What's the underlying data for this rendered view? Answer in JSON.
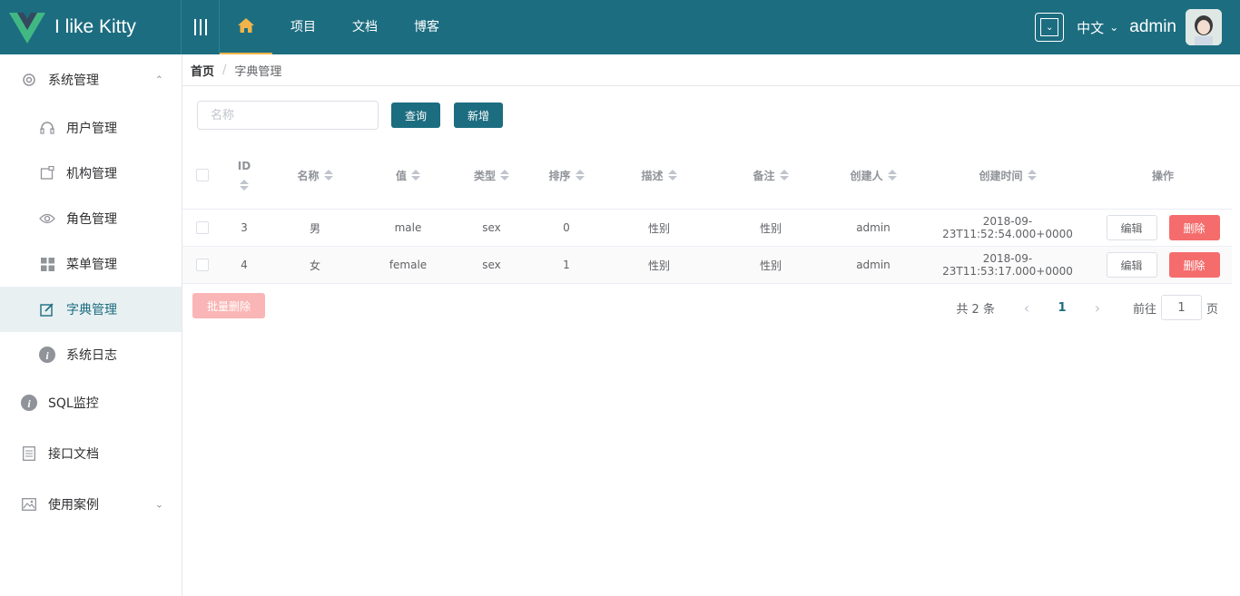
{
  "app": {
    "title": "I like Kitty",
    "logo_icon": "vue-logo-icon",
    "brand_color": "#1c6d80",
    "accent_color": "#f0b44b"
  },
  "nav": {
    "items": [
      {
        "label": "",
        "icon": "home-icon"
      },
      {
        "label": "项目"
      },
      {
        "label": "文档"
      },
      {
        "label": "博客"
      }
    ]
  },
  "header": {
    "lang": "中文",
    "user": "admin"
  },
  "sidebar": {
    "items": [
      {
        "label": "系统管理",
        "icon": "gear-icon",
        "expanded": true
      },
      {
        "label": "用户管理",
        "icon": "headset-icon"
      },
      {
        "label": "机构管理",
        "icon": "org-icon"
      },
      {
        "label": "角色管理",
        "icon": "eye-icon"
      },
      {
        "label": "菜单管理",
        "icon": "grid-icon"
      },
      {
        "label": "字典管理",
        "icon": "edit-icon",
        "active": true
      },
      {
        "label": "系统日志",
        "icon": "info-icon"
      },
      {
        "label": "SQL监控",
        "icon": "info-icon"
      },
      {
        "label": "接口文档",
        "icon": "document-icon"
      },
      {
        "label": "使用案例",
        "icon": "picture-icon"
      }
    ]
  },
  "breadcrumb": {
    "home": "首页",
    "current": "字典管理"
  },
  "toolbar": {
    "search_placeholder": "名称",
    "query_label": "查询",
    "add_label": "新增"
  },
  "table": {
    "headers": {
      "id": "ID",
      "name": "名称",
      "value": "值",
      "type": "类型",
      "sort": "排序",
      "desc": "描述",
      "remark": "备注",
      "creator": "创建人",
      "time": "创建时间",
      "ops": "操作"
    },
    "rows": [
      {
        "id": "3",
        "name": "男",
        "value": "male",
        "type": "sex",
        "sort": "0",
        "desc": "性别",
        "remark": "性别",
        "creator": "admin",
        "time": "2018-09-23T11:52:54.000+0000"
      },
      {
        "id": "4",
        "name": "女",
        "value": "female",
        "type": "sex",
        "sort": "1",
        "desc": "性别",
        "remark": "性别",
        "creator": "admin",
        "time": "2018-09-23T11:53:17.000+0000"
      }
    ],
    "edit_label": "编辑",
    "delete_label": "删除"
  },
  "batch_delete_label": "批量删除",
  "pagination": {
    "total": "共 2 条",
    "current": "1",
    "goto_prefix": "前往",
    "goto_value": "1",
    "goto_suffix": "页"
  }
}
